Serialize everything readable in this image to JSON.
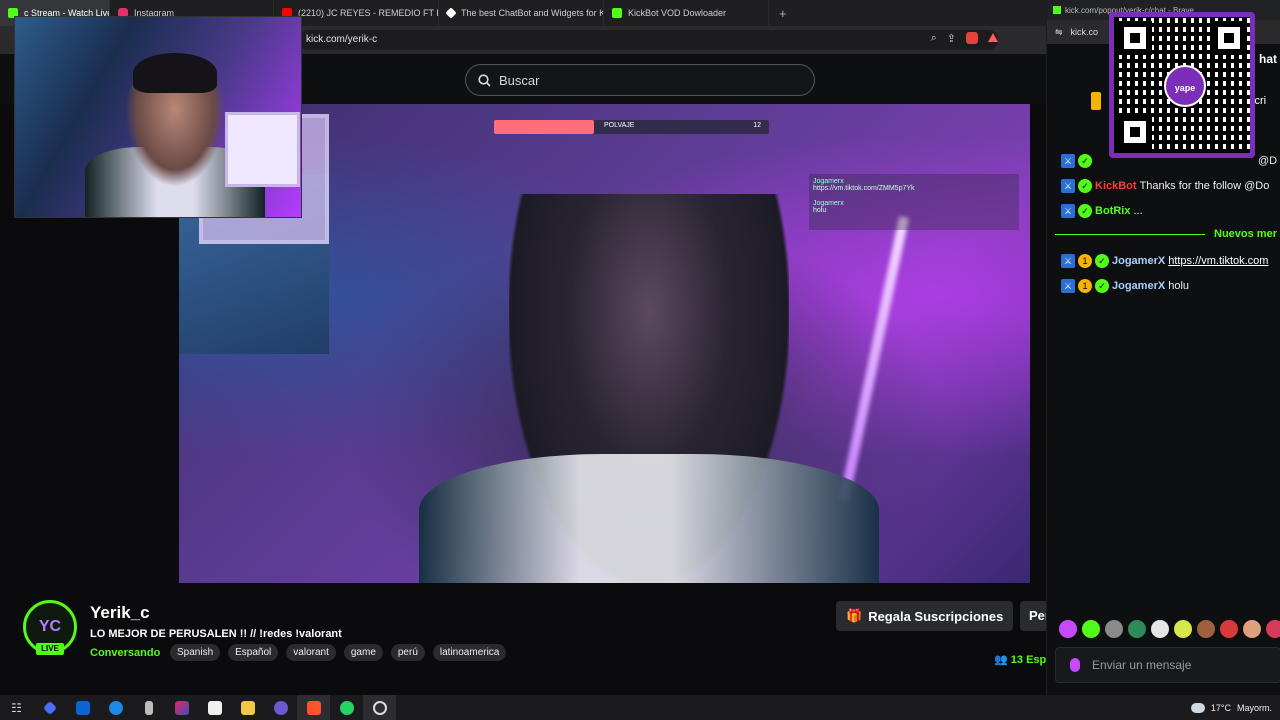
{
  "browser": {
    "tabs": [
      {
        "label": "c Stream - Watch Live o",
        "active": true,
        "icon_color": "#53fc18"
      },
      {
        "label": "Instagram",
        "icon_color": "#e1306c"
      },
      {
        "label": "(2210) JC REYES - REMEDIO FT Pl",
        "icon_color": "#ff0000"
      },
      {
        "label": "The best ChatBot and Widgets for K",
        "icon_color": "#ffffff"
      },
      {
        "label": "KickBot VOD Dowloader",
        "icon_color": "#53fc18"
      }
    ],
    "tab_close": "×",
    "new_tab": "+",
    "url": "kick.com/yerik-c"
  },
  "site": {
    "search_placeholder": "Buscar"
  },
  "video_overlay": {
    "bar_label": "POLVAJE",
    "bar_count": "12",
    "chat_line_1_user": "Jogamerx",
    "chat_line_1_text": "https://vm.tiktok.com/ZMM5p7Yk",
    "chat_line_2_user": "Jogamerx",
    "chat_line_2_text": "holu"
  },
  "channel": {
    "avatar_initials": "YC",
    "live_label": "LIVE",
    "name": "Yerik_c",
    "title": "LO MEJOR DE PERUSALEN !! // !redes !valorant",
    "category": "Conversando",
    "tags": [
      "Spanish",
      "Español",
      "valorant",
      "game",
      "perú",
      "latinoamerica"
    ],
    "gift_label": "Regala Suscripciones",
    "follow_label": "Per",
    "viewers_count": "13",
    "viewers_suffix": "Esp"
  },
  "chat": {
    "window_url": "kick.com/popout/yerik-c/chat - Brave",
    "address_short": "kick.co",
    "header_tail": "hat",
    "sub_peek": "scri",
    "qr_logo": "yape",
    "messages": [
      {
        "user": "",
        "text": "@D",
        "user_color": "green",
        "badges": [
          "mod",
          "verified"
        ]
      },
      {
        "user": "KickBot",
        "text": "Thanks for the follow @Do",
        "user_color": "red",
        "badges": [
          "mod",
          "verified"
        ]
      },
      {
        "user": "BotRix",
        "text": "...",
        "user_color": "green",
        "badges": [
          "mod",
          "verified"
        ]
      },
      {
        "user": "JogamerX",
        "text": "https://vm.tiktok.com",
        "user_color": "blue",
        "badges": [
          "mod",
          "sub",
          "verified"
        ],
        "is_link": true
      },
      {
        "user": "JogamerX",
        "text": "holu",
        "user_color": "blue",
        "badges": [
          "mod",
          "sub",
          "verified"
        ]
      }
    ],
    "new_messages_label": "Nuevos mer",
    "input_placeholder": "Enviar un mensaje",
    "emote_colors": [
      "#c64bff",
      "#53fc18",
      "#8a8a8a",
      "#2e8b57",
      "#e6e6e6",
      "#d6e84a",
      "#a06040",
      "#d83a3a",
      "#e0a080",
      "#d83a5a"
    ]
  },
  "taskbar": {
    "weather": "17°C",
    "weather_desc": "Mayorm."
  }
}
